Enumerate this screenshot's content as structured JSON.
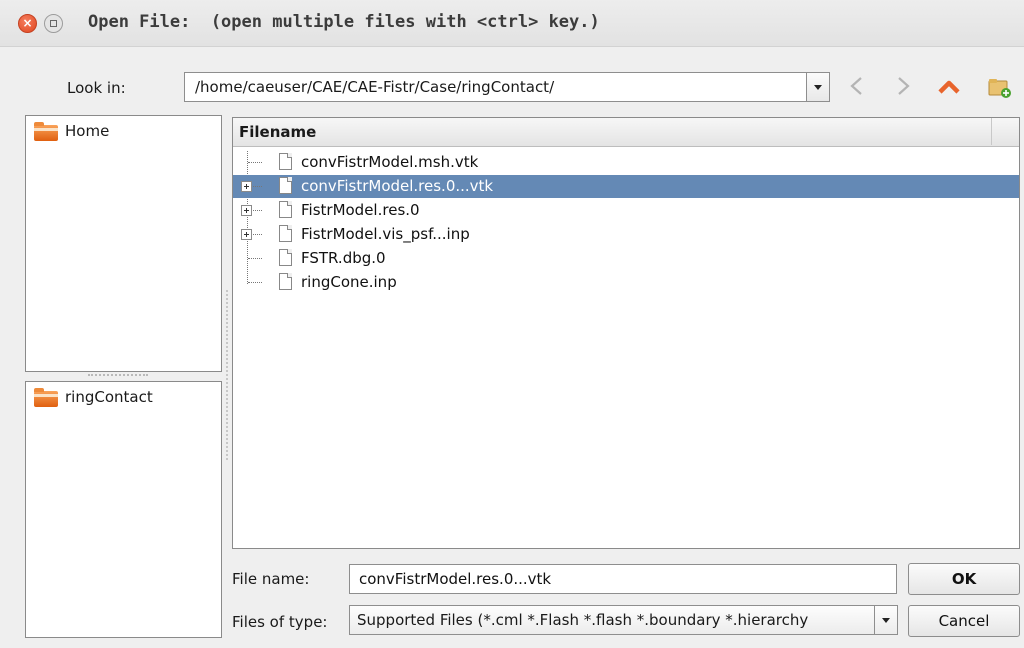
{
  "dialog": {
    "title": "Open File:  (open multiple files with <ctrl> key.)"
  },
  "look_in": {
    "label": "Look in:",
    "path": "/home/caeuser/CAE/CAE-Fistr/Case/ringContact/"
  },
  "nav_icons": [
    "back-icon",
    "forward-icon",
    "up-icon",
    "new-folder-icon"
  ],
  "colors": {
    "selection": "#6489b5",
    "up_arrow": "#e8642c",
    "folder": "#f08a32"
  },
  "places": {
    "favorites": [
      {
        "label": "Home"
      }
    ],
    "recent": [
      {
        "label": "ringContact"
      }
    ]
  },
  "file_list": {
    "header": "Filename",
    "rows": [
      {
        "name": "convFistrModel.msh.vtk",
        "expandable": false,
        "selected": false
      },
      {
        "name": "convFistrModel.res.0...vtk",
        "expandable": true,
        "selected": true
      },
      {
        "name": "FistrModel.res.0",
        "expandable": true,
        "selected": false
      },
      {
        "name": "FistrModel.vis_psf...inp",
        "expandable": true,
        "selected": false
      },
      {
        "name": "FSTR.dbg.0",
        "expandable": false,
        "selected": false
      },
      {
        "name": "ringCone.inp",
        "expandable": false,
        "selected": false
      }
    ]
  },
  "file_name": {
    "label": "File name:",
    "value": "convFistrModel.res.0...vtk"
  },
  "file_type": {
    "label": "Files of type:",
    "value": "Supported Files (*.cml  *.Flash *.flash  *.boundary *.hierarchy"
  },
  "buttons": {
    "ok": "OK",
    "cancel": "Cancel"
  }
}
